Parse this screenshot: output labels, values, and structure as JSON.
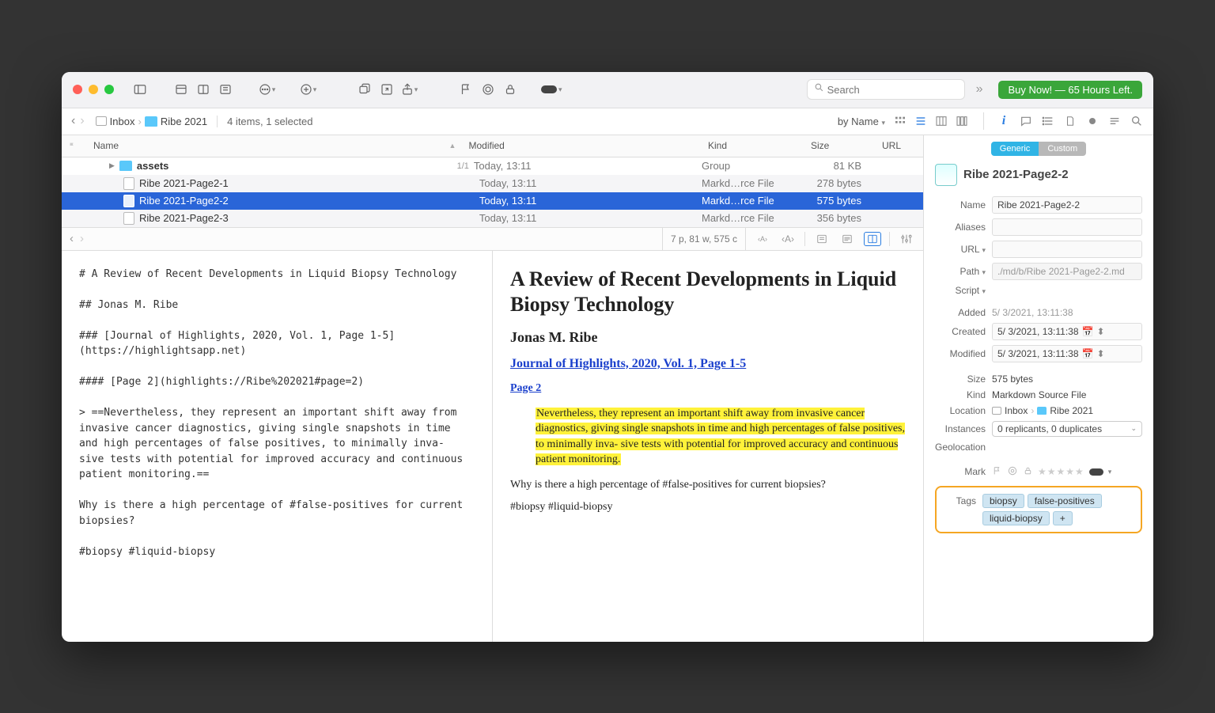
{
  "titlebar": {
    "search_placeholder": "Search",
    "buy_now": "Buy Now! — 65 Hours Left."
  },
  "pathbar": {
    "inbox": "Inbox",
    "folder": "Ribe 2021",
    "status": "4 items, 1 selected",
    "sort": "by Name"
  },
  "columns": {
    "name": "Name",
    "modified": "Modified",
    "kind": "Kind",
    "size": "Size",
    "url": "URL"
  },
  "rows": [
    {
      "name": "assets",
      "count": "1/1",
      "modified": "Today, 13:11",
      "kind": "Group",
      "size": "81 KB",
      "folder": true
    },
    {
      "name": "Ribe 2021-Page2-1",
      "modified": "Today, 13:11",
      "kind": "Markd…rce File",
      "size": "278 bytes"
    },
    {
      "name": "Ribe 2021-Page2-2",
      "modified": "Today, 13:11",
      "kind": "Markd…rce File",
      "size": "575 bytes",
      "selected": true
    },
    {
      "name": "Ribe 2021-Page2-3",
      "modified": "Today, 13:11",
      "kind": "Markd…rce File",
      "size": "356 bytes"
    }
  ],
  "editorbar": {
    "status": "7 p, 81 w, 575 c"
  },
  "source": "# A Review of Recent Developments in Liquid Biopsy Technology\n\n## Jonas M. Ribe\n\n### [Journal of Highlights, 2020, Vol. 1, Page 1-5](https://highlightsapp.net)\n\n#### [Page 2](highlights://Ribe%202021#page=2)\n\n> ==Nevertheless, they represent an important shift away from invasive cancer diagnostics, giving single snapshots in time and high percentages of false positives, to minimally inva- sive tests with potential for improved accuracy and continuous patient monitoring.==\n\nWhy is there a high percentage of #false-positives for current biopsies?\n\n#biopsy #liquid-biopsy",
  "preview": {
    "h1": "A Review of Recent Developments in Liquid Biopsy Technology",
    "h2": "Jonas M. Ribe",
    "link1": "Journal of Highlights, 2020, Vol. 1, Page 1-5",
    "link2": "Page 2",
    "highlight": "Nevertheless, they represent an important shift away from invasive cancer diagnostics, giving single snapshots in time and high percentages of false positives, to minimally inva- sive tests with potential for improved accuracy and continuous patient monitoring.",
    "p1": "Why is there a high percentage of #false-positives for current biopsies?",
    "p2": "#biopsy #liquid-biopsy"
  },
  "inspector": {
    "seg_generic": "Generic",
    "seg_custom": "Custom",
    "title": "Ribe 2021-Page2-2",
    "name_label": "Name",
    "name_value": "Ribe 2021-Page2-2",
    "aliases_label": "Aliases",
    "url_label": "URL",
    "path_label": "Path",
    "path_value": "./md/b/Ribe 2021-Page2-2.md",
    "script_label": "Script",
    "added_label": "Added",
    "added_value": "5/  3/2021, 13:11:38",
    "created_label": "Created",
    "created_value": "5/  3/2021, 13:11:38",
    "modified_label": "Modified",
    "modified_value": "5/  3/2021, 13:11:38",
    "size_label": "Size",
    "size_value": "575 bytes",
    "kind_label": "Kind",
    "kind_value": "Markdown Source File",
    "location_label": "Location",
    "loc_inbox": "Inbox",
    "loc_folder": "Ribe 2021",
    "instances_label": "Instances",
    "instances_value": "0 replicants, 0 duplicates",
    "geo_label": "Geolocation",
    "mark_label": "Mark",
    "tags_label": "Tags",
    "tags": [
      "biopsy",
      "false-positives",
      "liquid-biopsy"
    ],
    "tag_add": "+"
  }
}
